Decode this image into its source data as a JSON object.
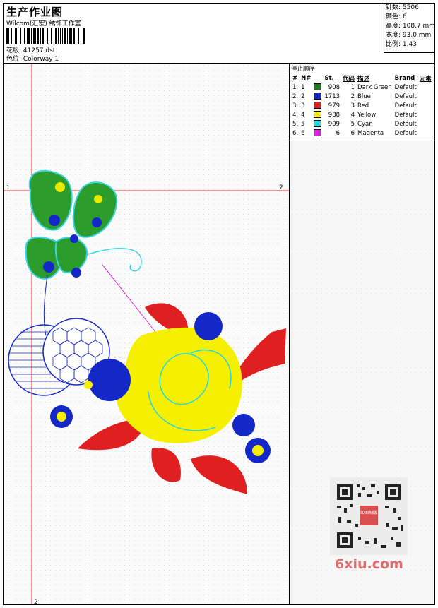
{
  "header": {
    "title": "生产作业图",
    "company": "Wilcom(汇宏) 绣饰工作室",
    "design_label": "花版: 41257.dst",
    "colorway_label": "色位: Colorway 1"
  },
  "stats": {
    "stitches": "针数: 5506",
    "colors": "颜色: 6",
    "height": "高度: 108.7 mm",
    "width": "宽度: 93.0 mm",
    "scale": "比例: 1.43"
  },
  "stop_sequence": {
    "title": "停止顺序:",
    "headers": [
      "#",
      "N#",
      "St.",
      "代码",
      "描述",
      "Brand",
      "元素"
    ],
    "rows": [
      {
        "n": "1.",
        "nn": "1",
        "st": "908",
        "code": "1",
        "desc": "Dark Green",
        "brand": "Default",
        "color": "#1a7a1a"
      },
      {
        "n": "2.",
        "nn": "2",
        "st": "1713",
        "code": "2",
        "desc": "Blue",
        "brand": "Default",
        "color": "#1428c8"
      },
      {
        "n": "3.",
        "nn": "3",
        "st": "979",
        "code": "3",
        "desc": "Red",
        "brand": "Default",
        "color": "#e02020"
      },
      {
        "n": "4.",
        "nn": "4",
        "st": "988",
        "code": "4",
        "desc": "Yellow",
        "brand": "Default",
        "color": "#f5f000"
      },
      {
        "n": "5.",
        "nn": "5",
        "st": "909",
        "code": "5",
        "desc": "Cyan",
        "brand": "Default",
        "color": "#20d8e0"
      },
      {
        "n": "6.",
        "nn": "6",
        "st": "6",
        "code": "6",
        "desc": "Magenta",
        "brand": "Default",
        "color": "#e020e0"
      }
    ]
  },
  "guides": {
    "h_start": "1",
    "h_end": "2",
    "v_start": "1",
    "v_end": "2"
  },
  "watermark": "6xiu.com",
  "qr_stamp": "印图制版"
}
